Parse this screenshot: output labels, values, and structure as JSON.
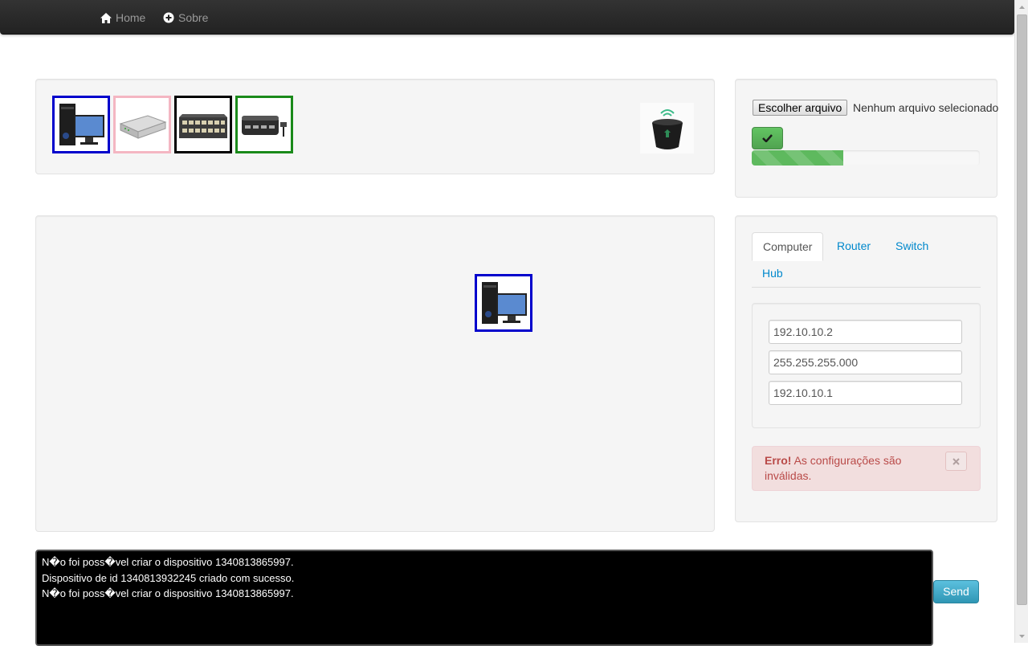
{
  "nav": {
    "home_label": "Home",
    "sobre_label": "Sobre"
  },
  "palette": {
    "devices": [
      {
        "name": "computer",
        "border_color": "#0000cc"
      },
      {
        "name": "router",
        "border_color": "#f4b6c2"
      },
      {
        "name": "switch",
        "border_color": "#000000"
      },
      {
        "name": "hub",
        "border_color": "#1a8a1a"
      }
    ],
    "trash_icon": "trash-bin-icon"
  },
  "upload": {
    "file_button_label": "Escolher arquivo",
    "file_status": "Nenhum arquivo selecionado",
    "progress_fraction": 0.4
  },
  "config": {
    "tabs": [
      {
        "label": "Computer",
        "active": true
      },
      {
        "label": "Router",
        "active": false
      },
      {
        "label": "Switch",
        "active": false
      },
      {
        "label": "Hub",
        "active": false
      }
    ],
    "fields": [
      {
        "value": "192.10.10.2"
      },
      {
        "value": "255.255.255.000"
      },
      {
        "value": "192.10.10.1"
      }
    ],
    "alert": {
      "strong": "Erro!",
      "message": " As configurações são inválidas.",
      "close_symbol": "×"
    }
  },
  "console": {
    "lines": [
      "N�o foi poss�vel criar o dispositivo 1340813865997.",
      "Dispositivo de id 1340813932245 criado com sucesso.",
      "N�o foi poss�vel criar o dispositivo 1340813865997."
    ],
    "send_label": "Send"
  },
  "colors": {
    "navbar": "#222222",
    "alert_text": "#b94a48",
    "progress": "#5eb95e",
    "send_button": "#49afcd"
  }
}
